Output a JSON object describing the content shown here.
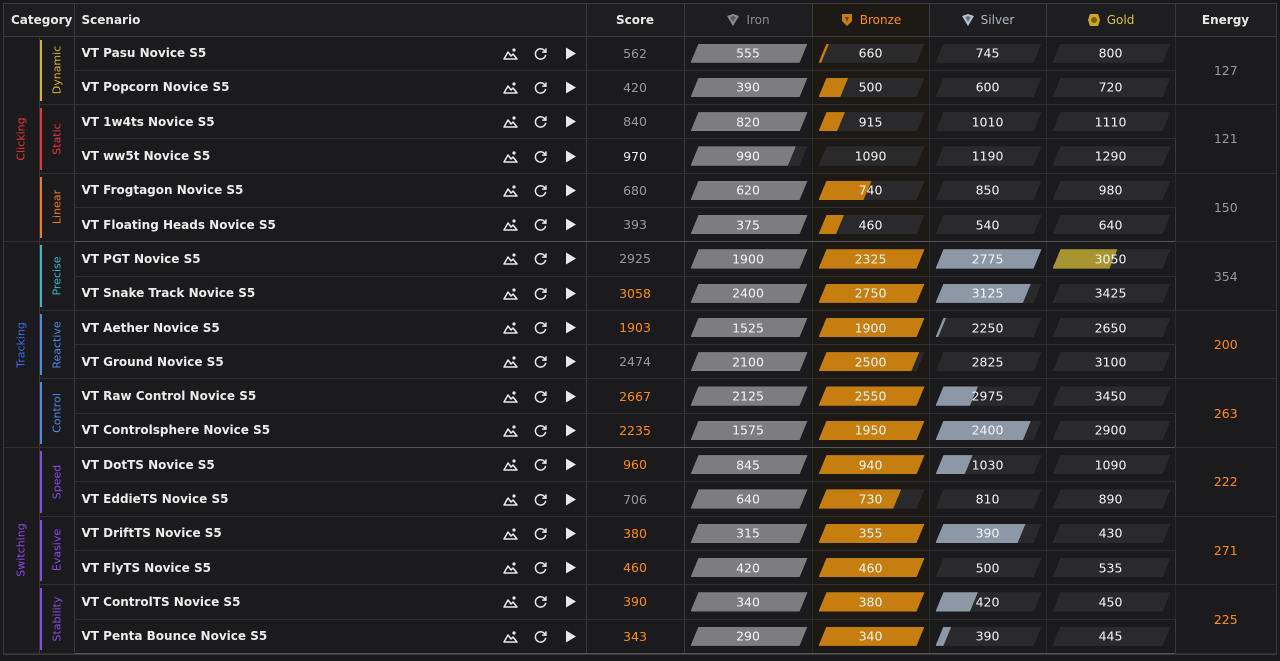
{
  "headers": {
    "category": "Category",
    "scenario": "Scenario",
    "score": "Score",
    "iron": "Iron",
    "bronze": "Bronze",
    "silver": "Silver",
    "gold": "Gold",
    "energy": "Energy"
  },
  "colors": {
    "iron": "#7d7d80",
    "bronze": "#c67e10",
    "silver": "#8d98a6",
    "gold": "#a89431",
    "score_orange": "#ff8c1a",
    "score_gray": "#9a9a9a"
  },
  "icons": {
    "scenario_actions": [
      "landscape-icon",
      "refresh-icon",
      "play-icon"
    ],
    "rank": [
      "iron-rank-icon",
      "bronze-rank-icon",
      "silver-rank-icon",
      "gold-rank-icon"
    ]
  },
  "categories": [
    {
      "name": "Clicking",
      "color": "#e8353e",
      "subs": [
        {
          "name": "Dynamic",
          "color": "#d8b13a",
          "energy": "127",
          "energy_color": "#9a9a9a",
          "rows": [
            {
              "name": "VT Pasu Novice S5",
              "score": "562",
              "score_color": "#9a9a9a",
              "ranks": [
                "555",
                "660",
                "745",
                "800"
              ],
              "fill": [
                1,
                0.1,
                0,
                0
              ]
            },
            {
              "name": "VT Popcorn Novice S5",
              "score": "420",
              "score_color": "#9a9a9a",
              "ranks": [
                "390",
                "500",
                "600",
                "720"
              ],
              "fill": [
                1,
                0.28,
                0,
                0
              ]
            }
          ]
        },
        {
          "name": "Static",
          "color": "#e8353e",
          "energy": "121",
          "energy_color": "#9a9a9a",
          "rows": [
            {
              "name": "VT 1w4ts Novice S5",
              "score": "840",
              "score_color": "#9a9a9a",
              "ranks": [
                "820",
                "915",
                "1010",
                "1110"
              ],
              "fill": [
                1,
                0.25,
                0,
                0
              ]
            },
            {
              "name": "VT ww5t Novice S5",
              "score": "970",
              "score_color": "#ececec",
              "ranks": [
                "990",
                "1090",
                "1190",
                "1290"
              ],
              "fill": [
                0.9,
                0,
                0,
                0
              ]
            }
          ]
        },
        {
          "name": "Linear",
          "color": "#f07a2a",
          "energy": "150",
          "energy_color": "#9a9a9a",
          "rows": [
            {
              "name": "VT Frogtagon Novice S5",
              "score": "680",
              "score_color": "#9a9a9a",
              "ranks": [
                "620",
                "740",
                "850",
                "980"
              ],
              "fill": [
                1,
                0.5,
                0,
                0
              ]
            },
            {
              "name": "VT Floating Heads Novice S5",
              "score": "393",
              "score_color": "#9a9a9a",
              "ranks": [
                "375",
                "460",
                "540",
                "640"
              ],
              "fill": [
                1,
                0.24,
                0,
                0
              ]
            }
          ]
        }
      ]
    },
    {
      "name": "Tracking",
      "color": "#3a6ae8",
      "subs": [
        {
          "name": "Precise",
          "color": "#3ab8c8",
          "energy": "354",
          "energy_color": "#9a9a9a",
          "rows": [
            {
              "name": "VT PGT Novice S5",
              "score": "2925",
              "score_color": "#9a9a9a",
              "ranks": [
                "1900",
                "2325",
                "2775",
                "3050"
              ],
              "fill": [
                1,
                1,
                1,
                0.55
              ]
            },
            {
              "name": "VT Snake Track Novice S5",
              "score": "3058",
              "score_color": "#ff8c1a",
              "ranks": [
                "2400",
                "2750",
                "3125",
                "3425"
              ],
              "fill": [
                1,
                1,
                0.9,
                0
              ]
            }
          ]
        },
        {
          "name": "Reactive",
          "color": "#4a8ae8",
          "energy": "200",
          "energy_color": "#ff8c1a",
          "rows": [
            {
              "name": "VT Aether Novice S5",
              "score": "1903",
              "score_color": "#ff8c1a",
              "ranks": [
                "1525",
                "1900",
                "2250",
                "2650"
              ],
              "fill": [
                1,
                1,
                0.1,
                0
              ]
            },
            {
              "name": "VT Ground Novice S5",
              "score": "2474",
              "score_color": "#9a9a9a",
              "ranks": [
                "2100",
                "2500",
                "2825",
                "3100"
              ],
              "fill": [
                1,
                0.95,
                0,
                0
              ]
            }
          ]
        },
        {
          "name": "Control",
          "color": "#4a8ae8",
          "energy": "263",
          "energy_color": "#ff8c1a",
          "rows": [
            {
              "name": "VT Raw Control Novice S5",
              "score": "2667",
              "score_color": "#ff8c1a",
              "ranks": [
                "2125",
                "2550",
                "2975",
                "3450"
              ],
              "fill": [
                1,
                1,
                0.4,
                0
              ]
            },
            {
              "name": "VT Controlsphere Novice S5",
              "score": "2235",
              "score_color": "#ff8c1a",
              "ranks": [
                "1575",
                "1950",
                "2400",
                "2900"
              ],
              "fill": [
                1,
                1,
                0.9,
                0
              ]
            }
          ]
        }
      ]
    },
    {
      "name": "Switching",
      "color": "#8a4ae8",
      "subs": [
        {
          "name": "Speed",
          "color": "#8a4ae8",
          "energy": "222",
          "energy_color": "#ff8c1a",
          "rows": [
            {
              "name": "VT DotTS Novice S5",
              "score": "960",
              "score_color": "#ff8c1a",
              "ranks": [
                "845",
                "940",
                "1030",
                "1090"
              ],
              "fill": [
                1,
                1,
                0.35,
                0
              ]
            },
            {
              "name": "VT EddieTS Novice S5",
              "score": "706",
              "score_color": "#9a9a9a",
              "ranks": [
                "640",
                "730",
                "810",
                "890"
              ],
              "fill": [
                1,
                0.78,
                0,
                0
              ]
            }
          ]
        },
        {
          "name": "Evasive",
          "color": "#8a4ae8",
          "energy": "271",
          "energy_color": "#ff8c1a",
          "rows": [
            {
              "name": "VT DriftTS Novice S5",
              "score": "380",
              "score_color": "#ff8c1a",
              "ranks": [
                "315",
                "355",
                "390",
                "430"
              ],
              "fill": [
                1,
                1,
                0.85,
                0
              ]
            },
            {
              "name": "VT FlyTS Novice S5",
              "score": "460",
              "score_color": "#ff8c1a",
              "ranks": [
                "420",
                "460",
                "500",
                "535"
              ],
              "fill": [
                1,
                1,
                0,
                0
              ]
            }
          ]
        },
        {
          "name": "Stability",
          "color": "#8a4ae8",
          "energy": "225",
          "energy_color": "#ff8c1a",
          "rows": [
            {
              "name": "VT ControlTS Novice S5",
              "score": "390",
              "score_color": "#ff8c1a",
              "ranks": [
                "340",
                "380",
                "420",
                "450"
              ],
              "fill": [
                1,
                1,
                0.4,
                0
              ]
            },
            {
              "name": "VT Penta Bounce Novice S5",
              "score": "343",
              "score_color": "#ff8c1a",
              "ranks": [
                "290",
                "340",
                "390",
                "445"
              ],
              "fill": [
                1,
                1,
                0.15,
                0
              ]
            }
          ]
        }
      ]
    }
  ]
}
